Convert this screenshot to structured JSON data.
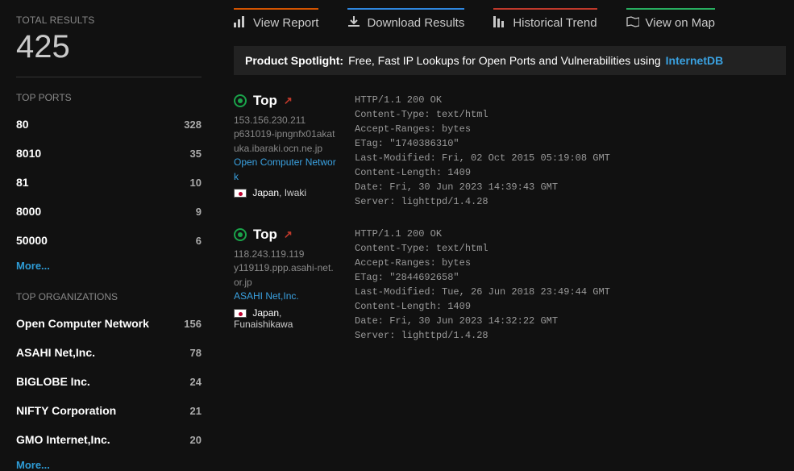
{
  "sidebar": {
    "total_label": "TOTAL RESULTS",
    "total_count": "425",
    "ports_title": "TOP PORTS",
    "ports": [
      {
        "value": "80",
        "count": "328"
      },
      {
        "value": "8010",
        "count": "35"
      },
      {
        "value": "81",
        "count": "10"
      },
      {
        "value": "8000",
        "count": "9"
      },
      {
        "value": "50000",
        "count": "6"
      }
    ],
    "ports_more": "More...",
    "orgs_title": "TOP ORGANIZATIONS",
    "orgs": [
      {
        "value": "Open Computer Network",
        "count": "156"
      },
      {
        "value": "ASAHI Net,Inc.",
        "count": "78"
      },
      {
        "value": "BIGLOBE Inc.",
        "count": "24"
      },
      {
        "value": "NIFTY Corporation",
        "count": "21"
      },
      {
        "value": "GMO Internet,Inc.",
        "count": "20"
      }
    ],
    "orgs_more": "More..."
  },
  "tabs": {
    "report": "View Report",
    "download": "Download Results",
    "trend": "Historical Trend",
    "map": "View on Map"
  },
  "spotlight": {
    "label": "Product Spotlight:",
    "text": "Free, Fast IP Lookups for Open Ports and Vulnerabilities using",
    "link": "InternetDB"
  },
  "results": [
    {
      "title": "Top",
      "ip": "153.156.230.211",
      "host": "p631019-ipngnfx01akatuka.ibaraki.ocn.ne.jp",
      "org": "Open Computer Network",
      "country": "Japan",
      "city": "Iwaki",
      "headers": "HTTP/1.1 200 OK\nContent-Type: text/html\nAccept-Ranges: bytes\nETag: \"1740386310\"\nLast-Modified: Fri, 02 Oct 2015 05:19:08 GMT\nContent-Length: 1409\nDate: Fri, 30 Jun 2023 14:39:43 GMT\nServer: lighttpd/1.4.28"
    },
    {
      "title": "Top",
      "ip": "118.243.119.119",
      "host": "y119119.ppp.asahi-net.or.jp",
      "org": "ASAHI Net,Inc.",
      "country": "Japan",
      "city": "Funaishikawa",
      "headers": "HTTP/1.1 200 OK\nContent-Type: text/html\nAccept-Ranges: bytes\nETag: \"2844692658\"\nLast-Modified: Tue, 26 Jun 2018 23:49:44 GMT\nContent-Length: 1409\nDate: Fri, 30 Jun 2023 14:32:22 GMT\nServer: lighttpd/1.4.28"
    }
  ]
}
